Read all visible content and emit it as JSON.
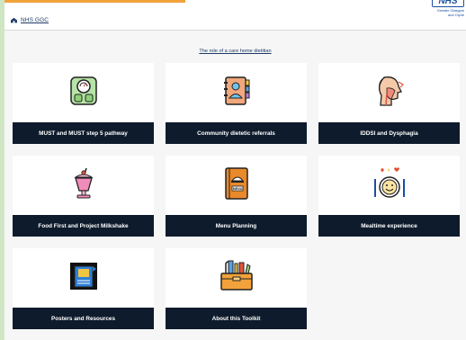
{
  "header": {
    "home_link": "NHS GGC",
    "nhs_logo": "NHS",
    "nhs_subtitle_line1": "Greater Glasgow",
    "nhs_subtitle_line2": "and Clyde",
    "accent_color": "#f2a23a",
    "logo_color": "#1a4fa0"
  },
  "intro": {
    "link_text": "The role of a care home dietitian"
  },
  "cards": [
    {
      "label": "MUST and MUST step 5 pathway",
      "icon": "weighing-scale-icon"
    },
    {
      "label": "Community dietetic referrals",
      "icon": "contact-book-icon"
    },
    {
      "label": "IDDSI and Dysphagia",
      "icon": "head-throat-icon"
    },
    {
      "label": "Food First and Project Milkshake",
      "icon": "milkshake-icon"
    },
    {
      "label": "Menu Planning",
      "icon": "menu-book-icon"
    },
    {
      "label": "Mealtime experience",
      "icon": "happy-plate-icon"
    },
    {
      "label": "Posters and Resources",
      "icon": "poster-icon"
    },
    {
      "label": "About this Toolkit",
      "icon": "toolbox-icon"
    }
  ],
  "colors": {
    "label_bg": "#0e1b2c",
    "page_bg": "#f6f6f6"
  }
}
